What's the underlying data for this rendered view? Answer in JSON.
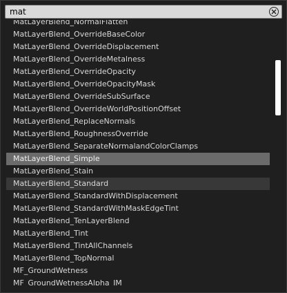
{
  "search": {
    "value": "mat",
    "clear_icon": "close-icon"
  },
  "list": {
    "items": [
      "MatLayerBlend_NormalFlatten",
      "MatLayerBlend_OverrideBaseColor",
      "MatLayerBlend_OverrideDisplacement",
      "MatLayerBlend_OverrideMetalness",
      "MatLayerBlend_OverrideOpacity",
      "MatLayerBlend_OverrideOpacityMask",
      "MatLayerBlend_OverrideSubSurface",
      "MatLayerBlend_OverrideWorldPositionOffset",
      "MatLayerBlend_ReplaceNormals",
      "MatLayerBlend_RoughnessOverride",
      "MatLayerBlend_SeparateNormalandColorClamps",
      "MatLayerBlend_Simple",
      "MatLayerBlend_Stain",
      "MatLayerBlend_Standard",
      "MatLayerBlend_StandardWithDisplacement",
      "MatLayerBlend_StandardWithMaskEdgeTint",
      "MatLayerBlend_TenLayerBlend",
      "MatLayerBlend_Tint",
      "MatLayerBlend_TintAllChannels",
      "MatLayerBlend_TopNormal",
      "MF_GroundWetness",
      "MF_GroundWetnessAlpha_IM"
    ],
    "selected_item": "MatLayerBlend_Simple",
    "hovered_item": "MatLayerBlend_Standard"
  },
  "colors": {
    "selected": "#6b6b6b",
    "hover": "#383838",
    "text": "#d8d8d8"
  }
}
